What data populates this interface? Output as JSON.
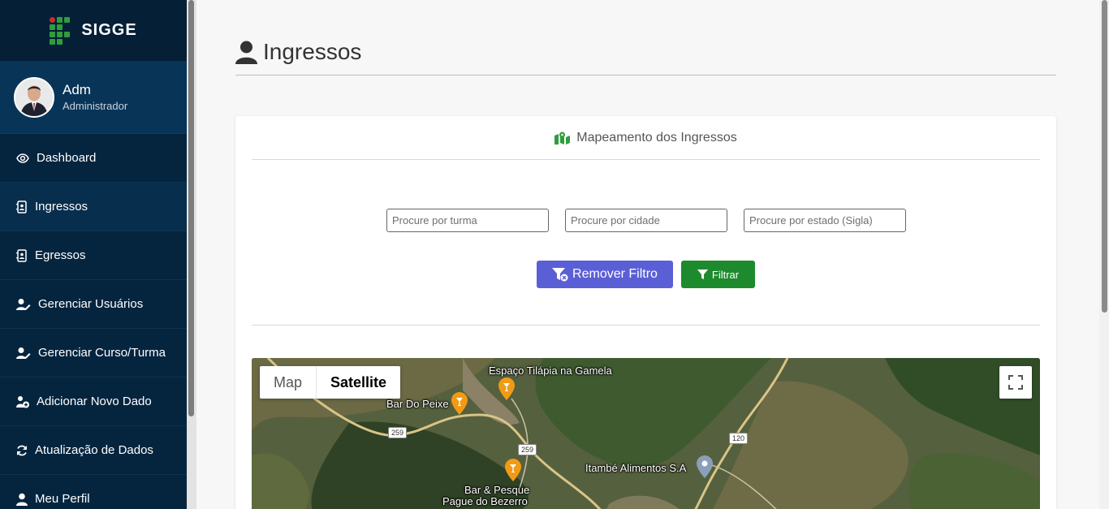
{
  "brand": {
    "title": "SIGGE"
  },
  "user": {
    "name": "Adm",
    "role": "Administrador"
  },
  "nav": [
    {
      "label": "Dashboard",
      "icon": "eye-icon"
    },
    {
      "label": "Ingressos",
      "icon": "address-book-icon"
    },
    {
      "label": "Egressos",
      "icon": "address-book-icon"
    },
    {
      "label": "Gerenciar Usuários",
      "icon": "user-edit-icon"
    },
    {
      "label": "Gerenciar Curso/Turma",
      "icon": "user-edit-icon"
    },
    {
      "label": "Adicionar Novo Dado",
      "icon": "user-plus-icon"
    },
    {
      "label": "Atualização de Dados",
      "icon": "sync-icon"
    },
    {
      "label": "Meu Perfil",
      "icon": "user-icon"
    }
  ],
  "page": {
    "title": "Ingressos"
  },
  "card": {
    "title": "Mapeamento dos Ingressos"
  },
  "filters": {
    "turma_placeholder": "Procure por turma",
    "cidade_placeholder": "Procure por cidade",
    "estado_placeholder": "Procure por estado (Sigla)"
  },
  "buttons": {
    "remove": "Remover Filtro",
    "filter": "Filtrar"
  },
  "map": {
    "type_map": "Map",
    "type_satellite": "Satellite",
    "places": [
      "Espaço Tilápia na Gamela",
      "Bar Do Peixe",
      "Itambé Alimentos S.A",
      "Bar & Pesque",
      "Pague do Bezerro"
    ],
    "roads": [
      "259",
      "259",
      "120"
    ]
  },
  "colors": {
    "sidebar": "#05253f",
    "primary": "#5b5fd6",
    "success": "#1e8a2e",
    "accent": "#2e9e3c"
  }
}
